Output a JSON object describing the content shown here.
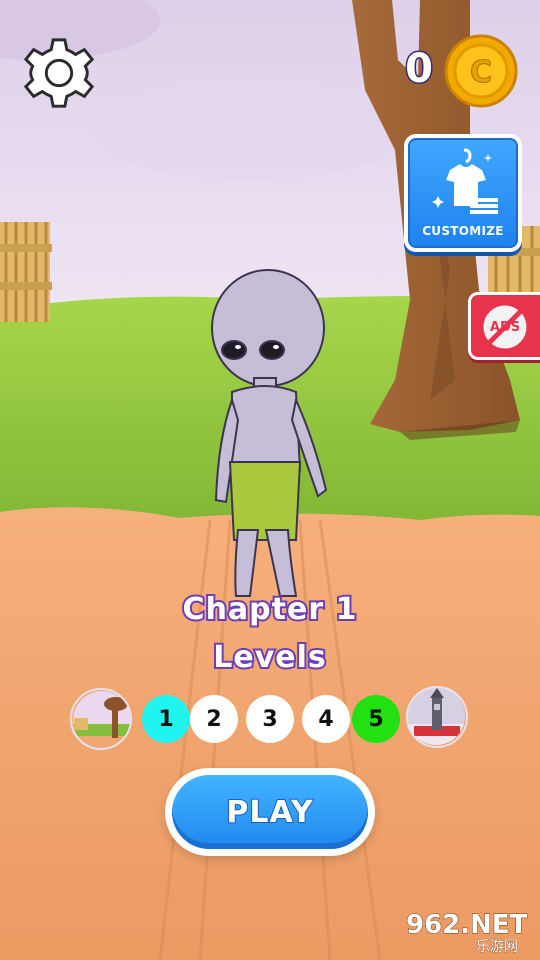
{
  "hud": {
    "coins": "0",
    "coin_symbol": "C",
    "settings_icon": "gear-icon"
  },
  "customize": {
    "label": "CUSTOMIZE",
    "icon": "shirt-hanger-icon"
  },
  "no_ads": {
    "label": "ADS",
    "icon": "no-ads-icon"
  },
  "chapter": {
    "title": "Chapter 1",
    "subtitle": "Levels",
    "levels": [
      "1",
      "2",
      "3",
      "4",
      "5"
    ],
    "current_level": "1",
    "boss_level": "5"
  },
  "play": {
    "label": "PLAY"
  },
  "watermark": {
    "main": "962.NET",
    "sub": "乐游网"
  },
  "colors": {
    "sky": "#e8dcf0",
    "grass": "#8cc43c",
    "ground": "#f2a56f",
    "button_blue": "#2b95f5",
    "current_level": "#1ff4f0",
    "boss_level": "#23e012",
    "no_ads_red": "#e8334d",
    "coin_gold": "#ffc21a"
  }
}
